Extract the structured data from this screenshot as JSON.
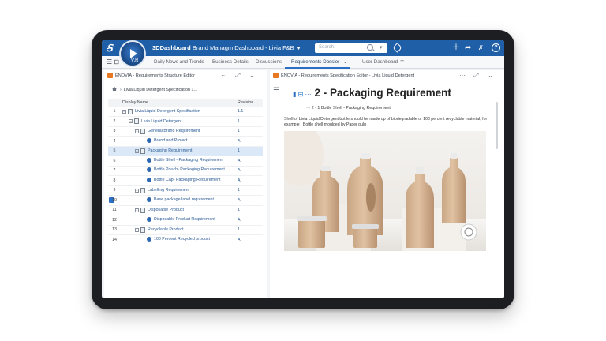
{
  "topbar": {
    "app_name": "3DDashboard",
    "dashboard_title": "Brand Managm Dashboard - Livia F&B",
    "search_placeholder": "Search",
    "compass_version": "V.R",
    "help": "?"
  },
  "tabs": [
    {
      "label": "Daily News and Trends"
    },
    {
      "label": "Business Details"
    },
    {
      "label": "Discussions"
    },
    {
      "label": "Requirements Dossier"
    },
    {
      "label": "User Dashboard"
    }
  ],
  "left_panel": {
    "title": "ENOVIA - Requirements Structure Editor",
    "breadcrumb": "Livia Liquid Detergent Specification 1.1",
    "columns": [
      "Display Name",
      "Revision"
    ],
    "rows": [
      {
        "num": "1",
        "name": "Livia Liquid Detergent Specification",
        "rev": "1.1"
      },
      {
        "num": "2",
        "name": "Livia Liquid Detergent",
        "rev": "1"
      },
      {
        "num": "3",
        "name": "General Brand Requirement",
        "rev": "1"
      },
      {
        "num": "4",
        "name": "Brand and Project",
        "rev": "A"
      },
      {
        "num": "5",
        "name": "Packaging Requirement",
        "rev": "1"
      },
      {
        "num": "6",
        "name": "Bottle Shell - Packaging Requirement",
        "rev": "A"
      },
      {
        "num": "7",
        "name": "Bottle Pouch- Packaging Requirement",
        "rev": "A"
      },
      {
        "num": "8",
        "name": "Bottle Cap- Packaging Requirement",
        "rev": "A"
      },
      {
        "num": "9",
        "name": "Labelling Requirement",
        "rev": "1"
      },
      {
        "num": "10",
        "name": "Base package label requirement",
        "rev": "A"
      },
      {
        "num": "11",
        "name": "Disposable Product",
        "rev": "1"
      },
      {
        "num": "12",
        "name": "Disposable Product Requirement",
        "rev": "A"
      },
      {
        "num": "13",
        "name": "Recyclable Product",
        "rev": "1"
      },
      {
        "num": "14",
        "name": "100 Percent Recycled product",
        "rev": "A"
      }
    ]
  },
  "right_panel": {
    "title": "ENOVIA - Requirements Specification Editor - Livia Liquid Detergent",
    "heading": "2 - Packaging Requirement",
    "sub_heading": "2 - 1  Bottle Shell - Packaging Requirement",
    "body": "Shell of Livia Liquid Detergent bottle should be made up of biodegradable or 100 percent recyclable material, for example : Bottle shell moulded by Paper pulp"
  }
}
